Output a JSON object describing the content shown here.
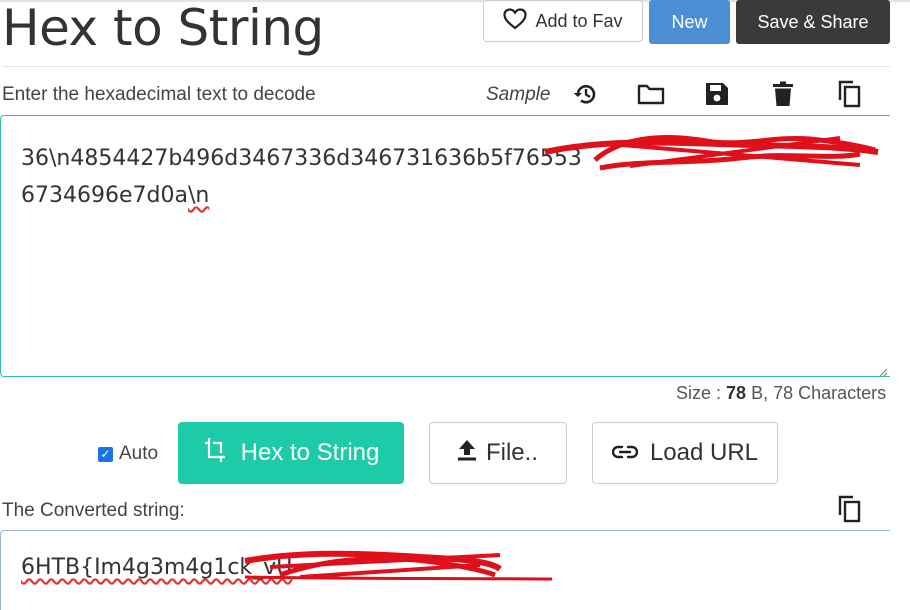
{
  "header": {
    "title": "Hex to String",
    "add_fav_label": "Add to Fav",
    "new_label": "New",
    "save_share_label": "Save & Share"
  },
  "input": {
    "label": "Enter the hexadecimal text to decode",
    "sample_label": "Sample",
    "line1": "36\\n4854427b496d3467336d346731636b5f76553",
    "line2_prefix": "6734696e7d0a",
    "line2_suffix": "\\n",
    "size_prefix": "Size : ",
    "size_bytes": "78",
    "size_suffix": " B, 78 Characters"
  },
  "actions": {
    "auto_label": "Auto",
    "convert_label": "Hex to String",
    "file_label": "File..",
    "load_url_label": "Load URL"
  },
  "output": {
    "label": "The Converted string:",
    "value": "6HTB{Im4g3m4g1ck_vU"
  },
  "icons": {
    "heart": "heart-icon",
    "history": "history-icon",
    "folder": "folder-icon",
    "save": "save-icon",
    "trash": "trash-icon",
    "copy": "copy-icon",
    "convert": "convert-icon",
    "upload": "upload-icon",
    "link": "link-icon"
  },
  "colors": {
    "new_button": "#4a8fd4",
    "share_button": "#3a3a3a",
    "convert_button": "#1dcba8",
    "input_border": "#2fc4a9",
    "redaction": "#e0101a"
  }
}
